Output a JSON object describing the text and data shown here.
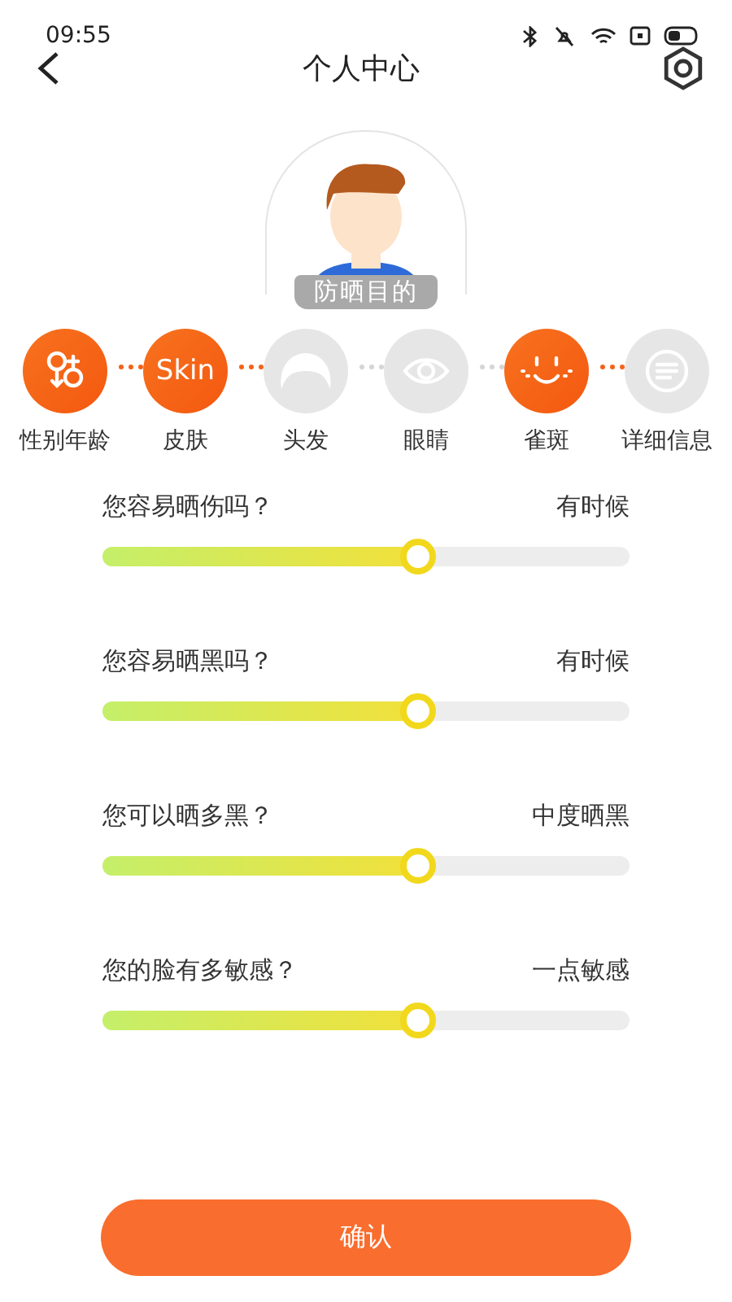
{
  "status_bar": {
    "time": "09:55"
  },
  "header": {
    "title": "个人中心"
  },
  "profile": {
    "label": "防晒目的"
  },
  "steps": [
    {
      "kind": "gender",
      "label": "性别年龄",
      "selected": true
    },
    {
      "kind": "text",
      "text": "Skin",
      "label": "皮肤",
      "selected": true
    },
    {
      "kind": "hair",
      "label": "头发",
      "selected": false
    },
    {
      "kind": "eye",
      "label": "眼睛",
      "selected": false
    },
    {
      "kind": "freckle",
      "label": "雀斑",
      "selected": true
    },
    {
      "kind": "list",
      "label": "详细信息",
      "selected": false
    }
  ],
  "questions": [
    {
      "question": "您容易晒伤吗？",
      "answer": "有时候",
      "level": 0.6
    },
    {
      "question": "您容易晒黑吗？",
      "answer": "有时候",
      "level": 0.6
    },
    {
      "question": "您可以晒多黑？",
      "answer": "中度晒黑",
      "level": 0.6
    },
    {
      "question": "您的脸有多敏感？",
      "answer": "一点敏感",
      "level": 0.6
    }
  ],
  "confirm_button": "确认"
}
